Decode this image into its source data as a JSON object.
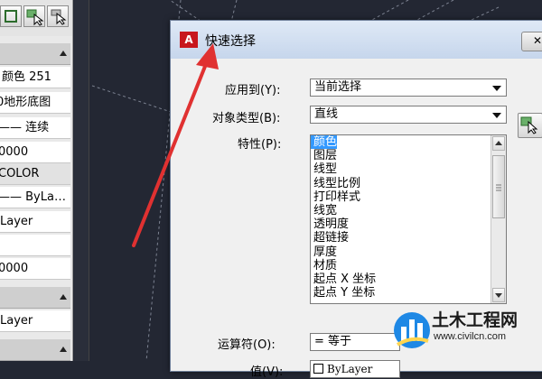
{
  "palette": {
    "rows": [
      "颜色 251",
      "0地形底图",
      "—— 连续",
      "0000",
      "COLOR",
      "—— ByLa…",
      "Layer",
      "",
      "0000"
    ],
    "bottom_row": "Layer"
  },
  "dialog": {
    "title": "快速选择",
    "app_icon_letter": "A",
    "close_glyph": "✕",
    "apply_to": {
      "label": "应用到(Y):",
      "value": "当前选择"
    },
    "object_type": {
      "label": "对象类型(B):",
      "value": "直线"
    },
    "properties": {
      "label": "特性(P):",
      "items": [
        "颜色",
        "图层",
        "线型",
        "线型比例",
        "打印样式",
        "线宽",
        "透明度",
        "超链接",
        "厚度",
        "材质",
        "起点 X 坐标",
        "起点 Y 坐标"
      ],
      "selected": "颜色"
    },
    "operator": {
      "label": "运算符(O):",
      "value": "= 等于"
    },
    "value": {
      "label": "值(V):",
      "value": "ByLayer"
    }
  },
  "watermark": {
    "name": "土木工程网",
    "url": "www.civilcn.com"
  },
  "colors": {
    "drawing_bg": "#232733",
    "title_bar": "#c6d6ec",
    "selection": "#3399ff",
    "arrow": "#e03131",
    "app_icon": "#c8161d",
    "watermark_logo": "#1e88e5"
  }
}
